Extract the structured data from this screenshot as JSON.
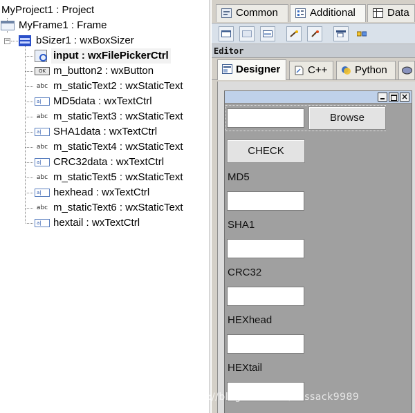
{
  "tree": {
    "nodes": [
      {
        "label": "MyProject1 : Project",
        "icon": "none"
      },
      {
        "label": "MyFrame1 : Frame",
        "icon": "frame-icon"
      },
      {
        "label": "bSizer1 : wxBoxSizer",
        "icon": "box-sizer-icon",
        "expander": "−"
      },
      {
        "label": "input : wxFilePickerCtrl",
        "icon": "file-picker-icon",
        "selected": true
      },
      {
        "label": "m_button2 : wxButton",
        "icon": "button-icon",
        "icon_text": "OK"
      },
      {
        "label": "m_staticText2 : wxStaticText",
        "icon": "static-text-icon",
        "icon_text": "abc"
      },
      {
        "label": "MD5data : wxTextCtrl",
        "icon": "text-ctrl-icon",
        "icon_text": "a|"
      },
      {
        "label": "m_staticText3 : wxStaticText",
        "icon": "static-text-icon",
        "icon_text": "abc"
      },
      {
        "label": "SHA1data : wxTextCtrl",
        "icon": "text-ctrl-icon",
        "icon_text": "a|"
      },
      {
        "label": "m_staticText4 : wxStaticText",
        "icon": "static-text-icon",
        "icon_text": "abc"
      },
      {
        "label": "CRC32data : wxTextCtrl",
        "icon": "text-ctrl-icon",
        "icon_text": "a|"
      },
      {
        "label": "m_staticText5 : wxStaticText",
        "icon": "static-text-icon",
        "icon_text": "abc"
      },
      {
        "label": "hexhead : wxTextCtrl",
        "icon": "text-ctrl-icon",
        "icon_text": "a|"
      },
      {
        "label": "m_staticText6 : wxStaticText",
        "icon": "static-text-icon",
        "icon_text": "abc"
      },
      {
        "label": "hextail : wxTextCtrl",
        "icon": "text-ctrl-icon",
        "icon_text": "a|"
      }
    ]
  },
  "palette": {
    "tabs": [
      {
        "label": "Common",
        "icon": "common-tab-icon"
      },
      {
        "label": "Additional",
        "icon": "additional-tab-icon"
      },
      {
        "label": "Data",
        "icon": "data-tab-icon"
      }
    ]
  },
  "toolbar": {
    "tools": [
      "frame-tool-icon",
      "panel-tool-icon",
      "dialog-tool-icon",
      "wand-tool-icon",
      "wand-alt-tool-icon",
      "menubar-tool-icon",
      "toolbar-tool-icon"
    ]
  },
  "editor": {
    "title": "Editor",
    "tabs": [
      {
        "label": "Designer",
        "icon": "designer-tab-icon",
        "active": true
      },
      {
        "label": "C++",
        "icon": "cpp-tab-icon"
      },
      {
        "label": "Python",
        "icon": "python-tab-icon"
      },
      {
        "label": "",
        "icon": "php-tab-icon"
      }
    ]
  },
  "form": {
    "window_buttons": {
      "min": "_",
      "max": "□",
      "close": "×"
    },
    "browse_label": "Browse",
    "check_label": "CHECK",
    "fields": [
      {
        "label": "MD5",
        "value": ""
      },
      {
        "label": "SHA1",
        "value": ""
      },
      {
        "label": "CRC32",
        "value": ""
      },
      {
        "label": "HEXhead",
        "value": ""
      },
      {
        "label": "HEXtail",
        "value": ""
      }
    ],
    "file_path_value": ""
  },
  "watermark": "http://blog.csdn.net/cossack9989",
  "colors": {
    "form_background": "#a0a0a0",
    "caption": "#bfd1ea",
    "sizer_icon": "#2a4fc9"
  }
}
